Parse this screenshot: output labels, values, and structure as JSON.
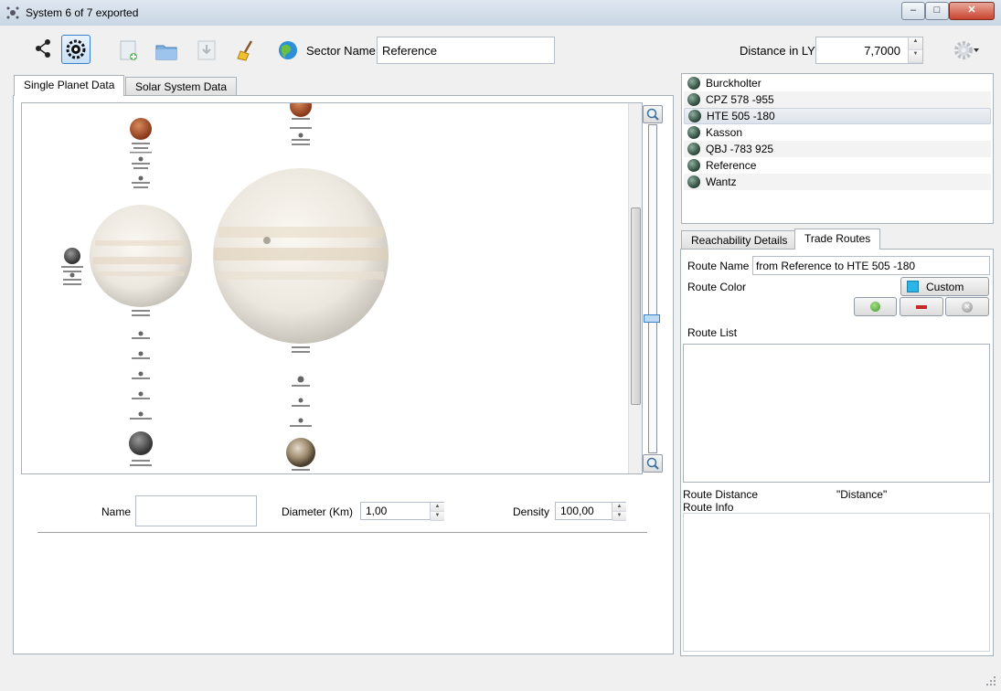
{
  "window": {
    "title": "System 6 of 7 exported",
    "minimize": "–",
    "maximize": "□",
    "close": "✕"
  },
  "toolbar": {
    "sector_label": "Sector Name",
    "sector_value": "Reference",
    "distance_label": "Distance in LY",
    "distance_value": "7,7000"
  },
  "left_tabs": [
    "Single Planet Data",
    "Solar System Data"
  ],
  "planet_form": {
    "name_label": "Name",
    "name_value": "",
    "diameter_label": "Diameter (Km)",
    "diameter_value": "1,00",
    "density_label": "Density",
    "density_value": "100,00"
  },
  "systems": [
    "Burckholter",
    "CPZ 578 -955",
    "HTE 505 -180",
    "Kasson",
    "QBJ -783 925",
    "Reference",
    "Wantz"
  ],
  "selected_system": "HTE 505 -180",
  "right_tabs": [
    "Reachability Details",
    "Trade Routes"
  ],
  "route": {
    "name_label": "Route Name",
    "name_value": "from Reference to HTE 505 -180",
    "color_label": "Route Color",
    "color_button": "Custom",
    "color_swatch": "#29b6e6",
    "list_label": "Route List",
    "distance_label": "Route Distance",
    "distance_value": "\"Distance\"",
    "info_label": "Route Info"
  },
  "colors": {
    "accent": "#3b7fc6",
    "remove": "#c62828",
    "add": "#5cb85c"
  }
}
